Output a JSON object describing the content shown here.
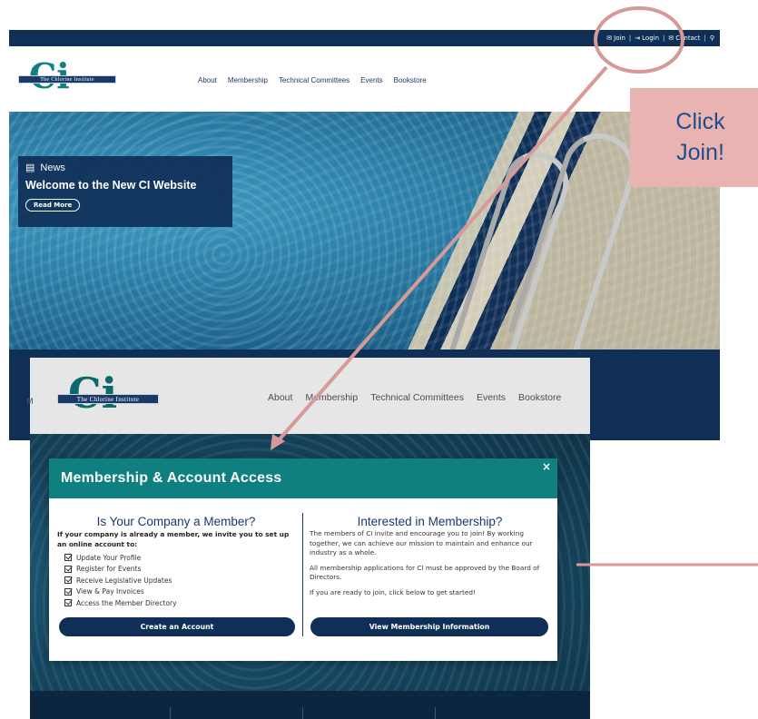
{
  "site": {
    "topbar": {
      "join": "Join",
      "login": "Login",
      "contact": "Contact",
      "separator": "|"
    },
    "logo": {
      "mark": "Ci",
      "name": "The Chlorine Institute"
    },
    "nav": [
      "About",
      "Membership",
      "Technical Committees",
      "Events",
      "Bookstore"
    ],
    "news": {
      "label": "News",
      "title": "Welcome to the New CI Website",
      "button": "Read More"
    }
  },
  "overlay_nav": {
    "nav": [
      "About",
      "Membership",
      "Technical Committees",
      "Events",
      "Bookstore"
    ],
    "left_edge_letter": "M"
  },
  "modal": {
    "title": "Membership & Account Access",
    "close": "×",
    "left": {
      "heading": "Is Your Company a Member?",
      "intro": "If your company is already a member, we invite you to set up an online account to:",
      "items": [
        "Update Your Profile",
        "Register for Events",
        "Receive Legislative Updates",
        "View & Pay Invoices",
        "Access the Member Directory"
      ],
      "button": "Create an Account"
    },
    "right": {
      "heading": "Interested in Membership?",
      "paragraphs": [
        "The members of CI invite and encourage you to join! By working together, we can achieve our mission to maintain and enhance our industry as a whole.",
        "All membership applications for CI must be approved by the Board of Directors.",
        "If you are ready to join, click below to get started!"
      ],
      "button": "View Membership Information"
    }
  },
  "annotation": {
    "callout_line1": "Click",
    "callout_line2": "Join!"
  },
  "colors": {
    "navy": "#0f2f57",
    "teal": "#0f7f80",
    "annotation_pink": "#e8b3b1",
    "annotation_line": "#d89a98",
    "callout_text": "#1f4e8c"
  }
}
